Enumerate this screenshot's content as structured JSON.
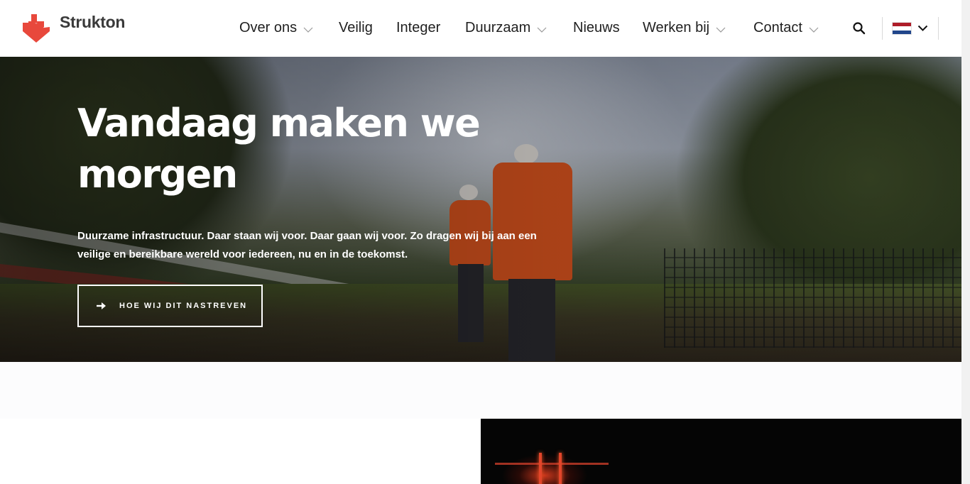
{
  "brand": {
    "name": "Strukton",
    "color": "#e8483c"
  },
  "nav": {
    "items": [
      {
        "label": "Over ons",
        "has_dropdown": true
      },
      {
        "label": "Veilig",
        "has_dropdown": false
      },
      {
        "label": "Integer",
        "has_dropdown": false
      },
      {
        "label": "Duurzaam",
        "has_dropdown": true
      },
      {
        "label": "Nieuws",
        "has_dropdown": false
      },
      {
        "label": "Werken bij",
        "has_dropdown": true
      },
      {
        "label": "Contact",
        "has_dropdown": true
      }
    ],
    "search_icon": "search-icon",
    "language": {
      "flag": "netherlands-flag",
      "icon": "chevron-down-icon"
    }
  },
  "hero": {
    "title": "Vandaag maken we morgen",
    "text": "Duurzame infrastructuur. Daar staan wij voor. Daar gaan wij voor. Zo dragen wij bij aan een veilige en bereikbare wereld voor iedereen, nu en in de toekomst.",
    "button": {
      "label": "HOE WIJ DIT NASTREVEN",
      "icon": "arrow-right-icon"
    }
  },
  "colors": {
    "text_dark": "#1f1f1f",
    "white": "#ffffff",
    "flag_red": "#ae1c28",
    "flag_white": "#ffffff",
    "flag_blue": "#21468b"
  }
}
